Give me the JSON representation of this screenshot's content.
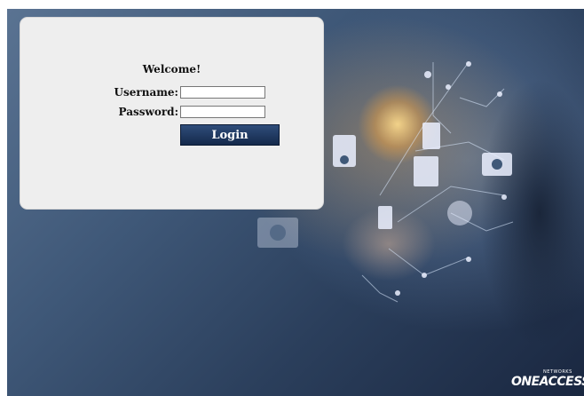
{
  "login": {
    "welcome": "Welcome!",
    "username_label": "Username:",
    "password_label": "Password:",
    "username_value": "",
    "password_value": "",
    "login_button": "Login"
  },
  "brand": {
    "logo_text": "ONEACCESS",
    "logo_subtext": "NETWORKS"
  },
  "colors": {
    "panel": "#eeeeee",
    "button": "#1f3a63"
  }
}
